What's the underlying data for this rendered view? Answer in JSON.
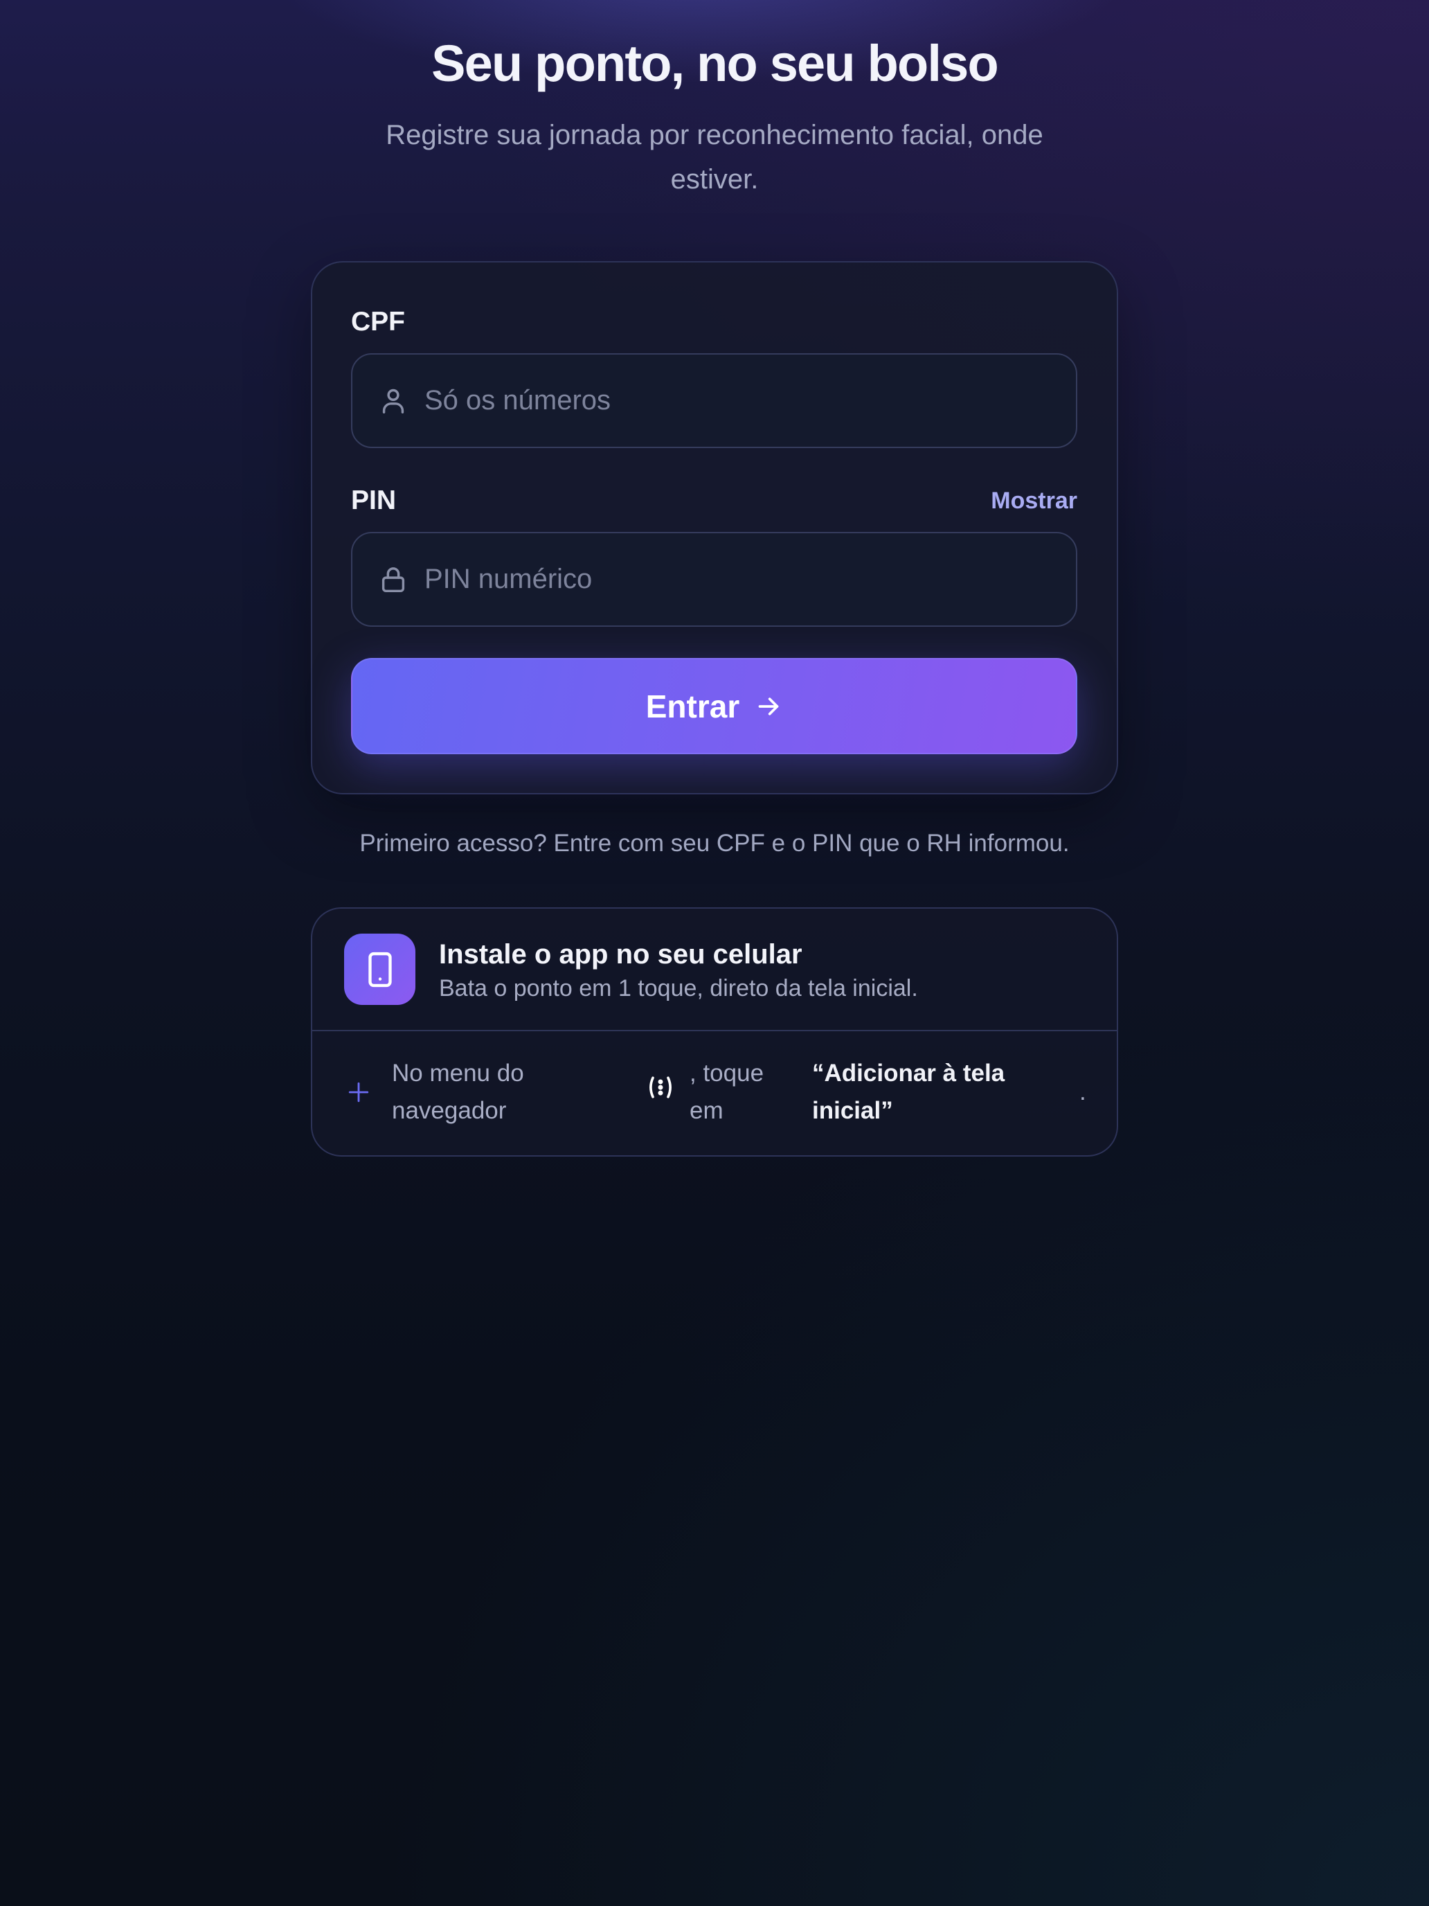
{
  "hero": {
    "title": "Seu ponto, no seu bolso",
    "subtitle": "Registre sua jornada por reconhecimento facial, onde estiver."
  },
  "login": {
    "cpf": {
      "label": "CPF",
      "placeholder": "Só os números",
      "value": "",
      "icon": "user-icon"
    },
    "pin": {
      "label": "PIN",
      "placeholder": "PIN numérico",
      "value": "",
      "icon": "lock-icon",
      "toggle_label": "Mostrar"
    },
    "submit": {
      "label": "Entrar",
      "icon": "arrow-right-icon"
    }
  },
  "first_access_note": "Primeiro acesso? Entre com seu CPF e o PIN que o RH informou.",
  "install": {
    "icon": "smartphone-icon",
    "title": "Instale o app no seu celular",
    "subtitle": "Bata o ponto em 1 toque, direto da tela inicial.",
    "step": {
      "icon": "plus-icon",
      "text_before": "No menu do navegador",
      "menu_glyph": "browser-menu-icon",
      "text_middle": ", toque em",
      "highlight": "“Adicionar à tela inicial”",
      "text_after": "."
    }
  },
  "colors": {
    "accent": "#6366f1",
    "accent_end": "#8b5cf6",
    "link": "#a5a8f5",
    "background_top": "#1e1c4b",
    "background_bottom": "#0a0f19",
    "card_border": "#2d3358"
  }
}
